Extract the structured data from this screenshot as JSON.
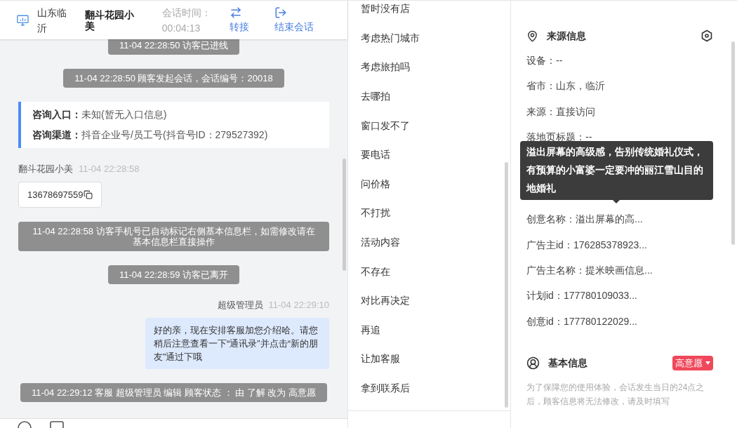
{
  "header": {
    "location": "山东临沂",
    "visitor": "翻斗花园小美",
    "timer_label": "会话时间：",
    "timer": "00:04:13",
    "actions": [
      {
        "label": "转接",
        "kind": "transfer"
      },
      {
        "label": "结束会话",
        "kind": "end"
      }
    ]
  },
  "messages": [
    {
      "kind": "system",
      "text": "11-04 22:28:50 访客已进线"
    },
    {
      "kind": "system",
      "text": "11-04 22:28:50 顾客发起会话，会话编号：20018"
    },
    {
      "kind": "info",
      "lines": [
        {
          "label": "咨询入口：",
          "value": "未知(暂无入口信息)"
        },
        {
          "label": "咨询渠道：",
          "value": "抖音企业号/员工号(抖音号ID：279527392)"
        }
      ]
    },
    {
      "kind": "visitor",
      "sender": "翻斗花园小美",
      "time": "11-04 22:28:58",
      "text": "13678697559"
    },
    {
      "kind": "system",
      "text": "11-04 22:28:58 访客手机号已自动标记右侧基本信息栏，如需修改请在基本信息栏直接操作"
    },
    {
      "kind": "system",
      "text": "11-04 22:28:59 访客已离开"
    },
    {
      "kind": "agent",
      "sender": "超级管理员",
      "time": "11-04 22:29:10",
      "text": "好的亲，现在安排客服加您介绍哈。请您稍后注意查看一下“通讯录”并点击“新的朋友”通过下哦"
    },
    {
      "kind": "system",
      "text": "11-04 22:29:12 客服 超级管理员 编辑 顾客状态 ： 由 了解 改为 高意愿"
    }
  ],
  "quick_replies": [
    "暂时没有店",
    "考虑热门城市",
    "考虑旅拍吗",
    "去哪拍",
    "窗口发不了",
    "要电话",
    "问价格",
    "不打扰",
    "活动内容",
    "不存在",
    "对比再决定",
    "再追",
    "让加客服",
    "拿到联系后"
  ],
  "source_info": {
    "title": "来源信息",
    "rows_above": [
      "设备：--",
      "省市：山东，临沂",
      "来源：直接访问",
      "落地页标题：--"
    ],
    "tooltip": "溢出屏幕的高级感，告别传统婚礼仪式，有预算的小富婆一定要冲的丽江雪山目的地婚礼",
    "rows_below": [
      "创意名称：溢出屏幕的高...",
      "广告主id：176285378923...",
      "广告主名称：提米映画信息...",
      "计划id：177780109033...",
      "创意id：177780122029..."
    ]
  },
  "basic_info": {
    "title": "基本信息",
    "status": "高意愿",
    "notice": "为了保障您的使用体验，会话发生当日的24点之后，顾客信息将无法修改，请及时填写"
  }
}
